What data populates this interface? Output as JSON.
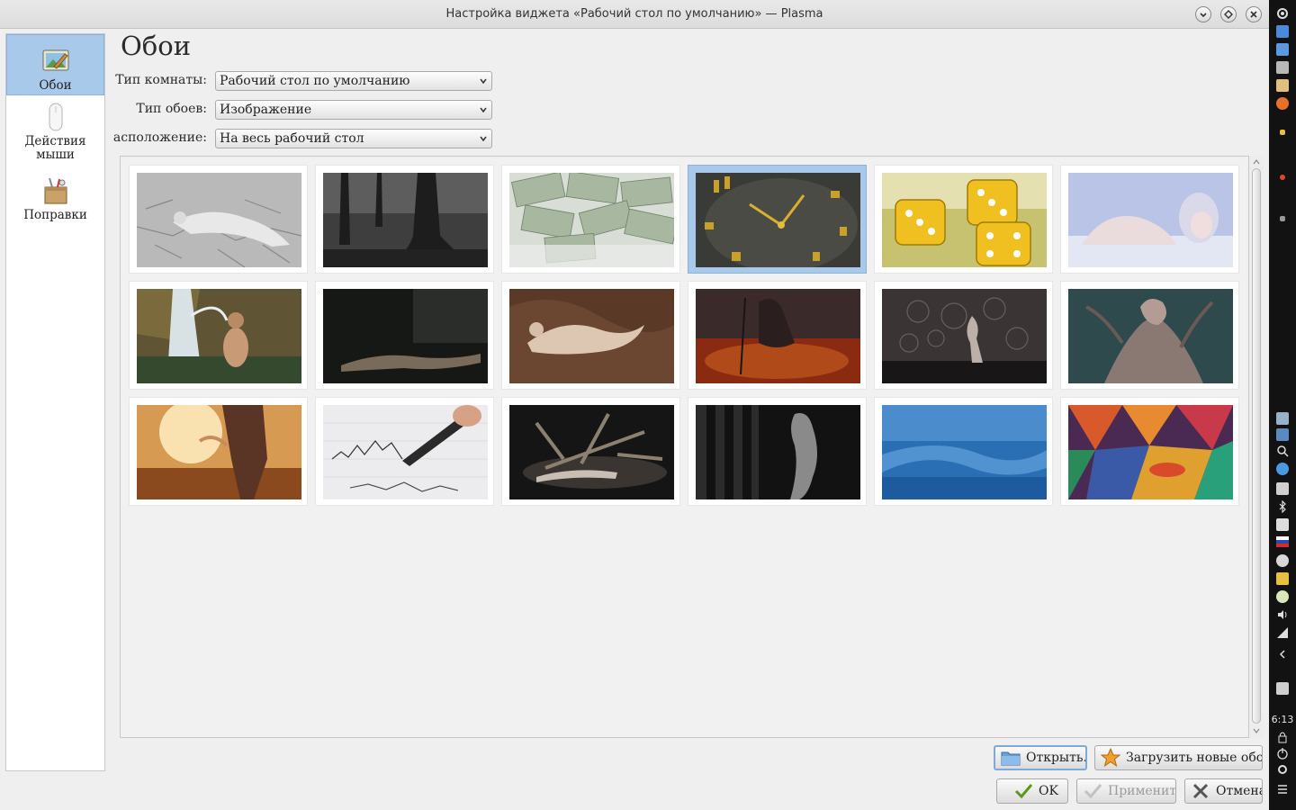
{
  "window": {
    "title": "Настройка виджета «Рабочий стол по умолчанию» — Plasma",
    "buttons": [
      "minimize-icon",
      "maximize-icon",
      "close-icon"
    ]
  },
  "sidebar": {
    "items": [
      {
        "label": "Обои",
        "icon": "wallpaper-icon",
        "active": true
      },
      {
        "label": "Действия мыши",
        "icon": "mouse-icon",
        "active": false
      },
      {
        "label": "Поправки",
        "icon": "tweaks-icon",
        "active": false
      }
    ]
  },
  "main": {
    "title": "Обои",
    "fields": [
      {
        "label": "Тип комнаты:",
        "value": "Рабочий стол по умолчанию"
      },
      {
        "label": "Тип обоев:",
        "value": "Изображение"
      },
      {
        "label": "асположение:",
        "value": "На весь рабочий стол"
      }
    ],
    "selected_index": 3,
    "wallpapers": [
      "cracked-earth-bw",
      "dark-forest-roots",
      "dollar-bills",
      "golden-clock",
      "yellow-dice",
      "pale-woman",
      "waterfall-woman",
      "dark-reclining-figure",
      "brown-silk-figure",
      "red-smoky-figure",
      "patterned-wall-dancer",
      "tree-embrace",
      "sunset-field-woman",
      "pen-writing-chart",
      "driftwood-dark",
      "dark-curtain-figure",
      "blue-waves",
      "colorful-polygons"
    ]
  },
  "buttons": {
    "open": "Открыть...",
    "download": "Загрузить новые обои...",
    "ok": "OK",
    "apply": "Применить",
    "cancel": "Отмена"
  },
  "taskbar": {
    "time": "6:13"
  },
  "colors": {
    "selection": "#a9c9ea",
    "selection_border": "#8cb2dc",
    "taskbar": "#121212"
  }
}
